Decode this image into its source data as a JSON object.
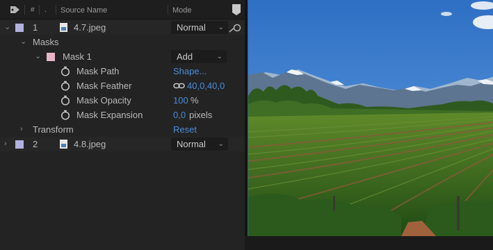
{
  "header": {
    "hash": "#",
    "dot": ".",
    "source_name": "Source Name",
    "mode": "Mode"
  },
  "layers": [
    {
      "number": "1",
      "name": "4.7.jpeg",
      "mode": "Normal",
      "label_color": "#b3b0e0",
      "masks_label": "Masks",
      "mask": {
        "name": "Mask 1",
        "mode": "Add",
        "label_color": "#e7b4c8",
        "properties": [
          {
            "name": "Mask Path",
            "value": "Shape..."
          },
          {
            "name": "Mask Feather",
            "value": "40,0,40,0"
          },
          {
            "name": "Mask Opacity",
            "value": "100",
            "unit": "%"
          },
          {
            "name": "Mask Expansion",
            "value": "0,0",
            "unit": "pixels"
          }
        ]
      },
      "transform_label": "Transform",
      "transform_value": "Reset"
    },
    {
      "number": "2",
      "name": "4.8.jpeg",
      "mode": "Normal",
      "label_color": "#b3b0e0"
    }
  ],
  "colors": {
    "accent_blue": "#4b8cd9",
    "panel_bg": "#232323"
  },
  "preview": {
    "icon": "vineyard-landscape-image"
  }
}
